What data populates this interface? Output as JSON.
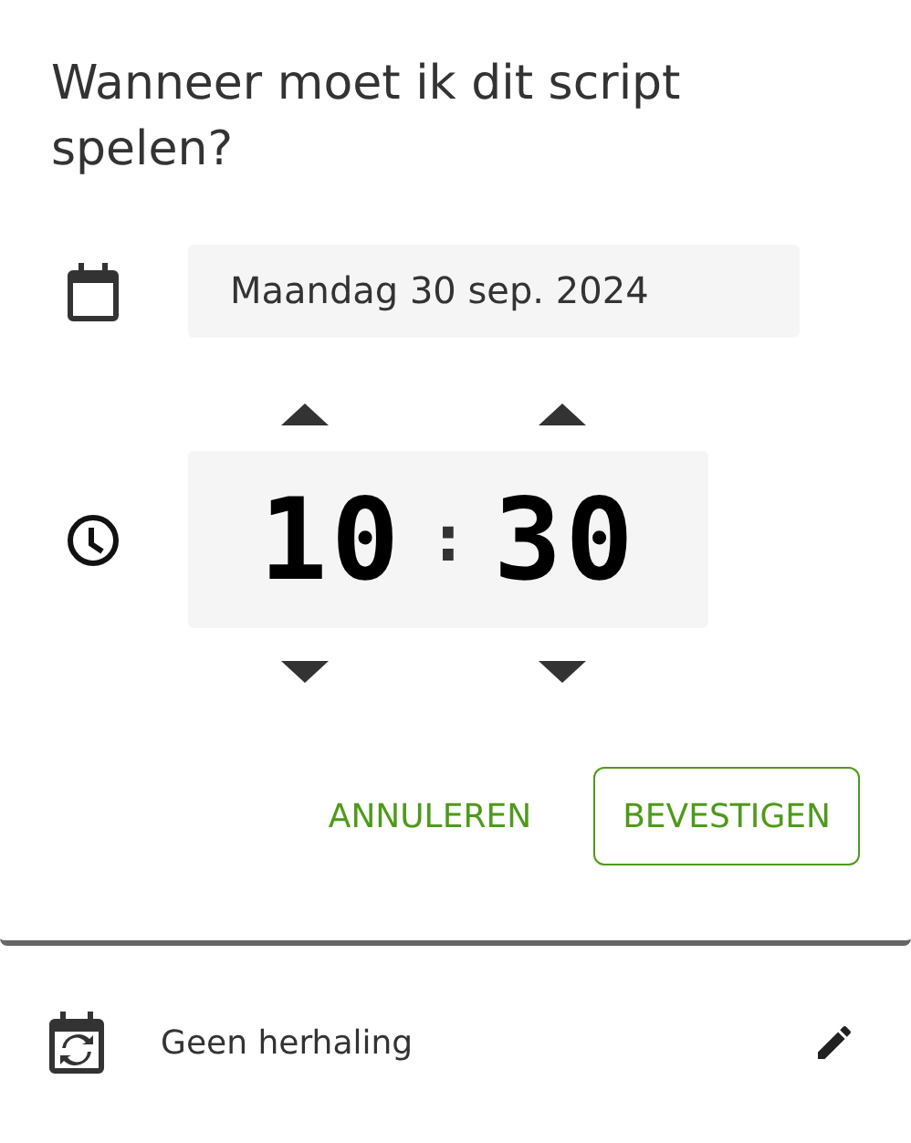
{
  "dialog": {
    "title": "Wanneer moet ik dit script spelen?",
    "date": {
      "value": "Maandag 30 sep. 2024"
    },
    "time": {
      "hours": "10",
      "separator": ":",
      "minutes": "30"
    },
    "buttons": [
      {
        "label": "ANNULEREN",
        "kind": "text"
      },
      {
        "label": "BEVESTIGEN",
        "kind": "outlined"
      }
    ]
  },
  "repeat": {
    "label": "Geen herhaling"
  }
}
